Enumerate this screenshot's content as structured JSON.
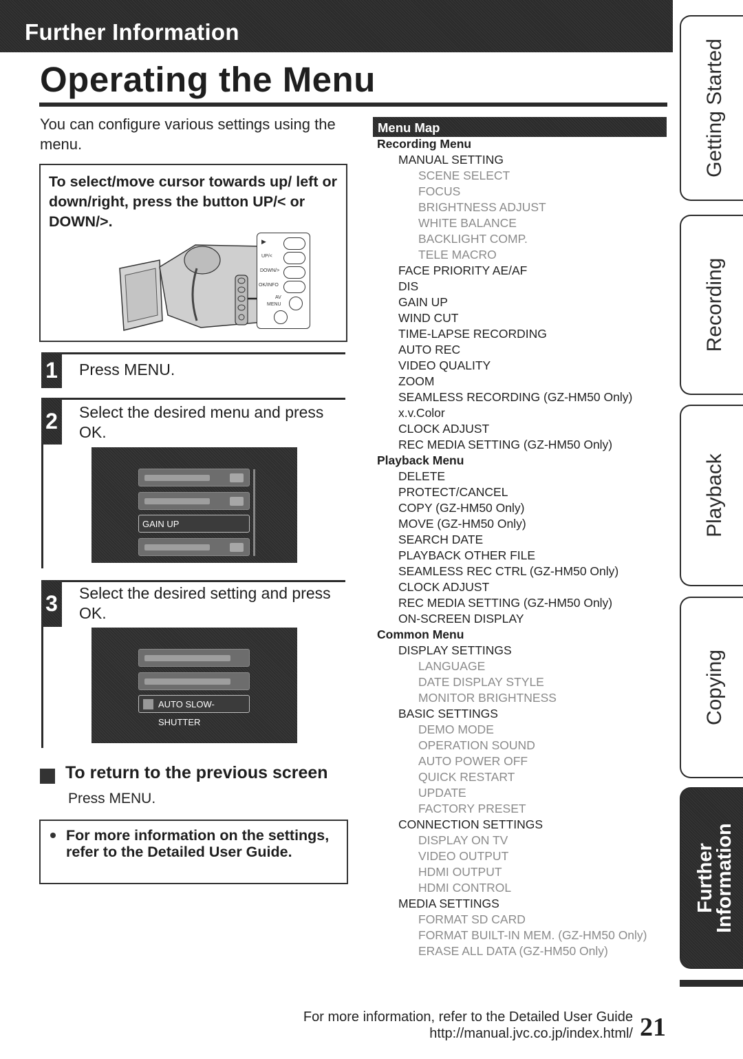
{
  "header": {
    "section_label": "Further Information",
    "page_title": "Operating the Menu"
  },
  "intro": "You can configure various settings using the menu.",
  "tip_box": {
    "text": "To select/move cursor towards up/ left or down/right, press the button UP/< or DOWN/>.",
    "panel_labels": [
      "▶",
      "UP/<",
      "DOWN/>",
      "OK/INFO",
      "AV",
      "MENU"
    ]
  },
  "steps": [
    {
      "number": "1",
      "text": "Press MENU."
    },
    {
      "number": "2",
      "text": "Select the desired menu and press OK.",
      "screen_items": [
        "",
        "",
        "GAIN UP",
        ""
      ],
      "selected_index": 2
    },
    {
      "number": "3",
      "text": "Select the desired setting and press OK.",
      "screen_items": [
        "",
        "",
        "AUTO SLOW-SHUTTER"
      ],
      "selected_index": 2
    }
  ],
  "return_section": {
    "heading": "To return to the previous screen",
    "text": "Press MENU."
  },
  "note": "For more information on the settings, refer to the Detailed User Guide.",
  "menu_map": {
    "title": "Menu Map",
    "items": [
      {
        "level": 0,
        "label": "Recording Menu"
      },
      {
        "level": 1,
        "label": "MANUAL SETTING"
      },
      {
        "level": 2,
        "label": "SCENE SELECT"
      },
      {
        "level": 2,
        "label": "FOCUS"
      },
      {
        "level": 2,
        "label": "BRIGHTNESS ADJUST"
      },
      {
        "level": 2,
        "label": "WHITE BALANCE"
      },
      {
        "level": 2,
        "label": "BACKLIGHT COMP."
      },
      {
        "level": 2,
        "label": "TELE MACRO"
      },
      {
        "level": 1,
        "label": "FACE PRIORITY AE/AF"
      },
      {
        "level": 1,
        "label": "DIS"
      },
      {
        "level": 1,
        "label": "GAIN UP"
      },
      {
        "level": 1,
        "label": "WIND CUT"
      },
      {
        "level": 1,
        "label": "TIME-LAPSE RECORDING"
      },
      {
        "level": 1,
        "label": "AUTO REC"
      },
      {
        "level": 1,
        "label": "VIDEO QUALITY"
      },
      {
        "level": 1,
        "label": "ZOOM"
      },
      {
        "level": 1,
        "label": "SEAMLESS RECORDING (GZ-HM50 Only)"
      },
      {
        "level": 1,
        "label": "x.v.Color"
      },
      {
        "level": 1,
        "label": "CLOCK ADJUST"
      },
      {
        "level": 1,
        "label": "REC MEDIA SETTING  (GZ-HM50 Only)"
      },
      {
        "level": 0,
        "label": "Playback Menu"
      },
      {
        "level": 1,
        "label": "DELETE"
      },
      {
        "level": 1,
        "label": "PROTECT/CANCEL"
      },
      {
        "level": 1,
        "label": "COPY (GZ-HM50 Only)"
      },
      {
        "level": 1,
        "label": "MOVE (GZ-HM50 Only)"
      },
      {
        "level": 1,
        "label": "SEARCH DATE"
      },
      {
        "level": 1,
        "label": "PLAYBACK OTHER FILE"
      },
      {
        "level": 1,
        "label": "SEAMLESS REC CTRL (GZ-HM50 Only)"
      },
      {
        "level": 1,
        "label": "CLOCK ADJUST"
      },
      {
        "level": 1,
        "label": "REC MEDIA SETTING (GZ-HM50 Only)"
      },
      {
        "level": 1,
        "label": "ON-SCREEN DISPLAY"
      },
      {
        "level": 0,
        "label": "Common Menu"
      },
      {
        "level": 1,
        "label": "DISPLAY SETTINGS"
      },
      {
        "level": 2,
        "label": "LANGUAGE"
      },
      {
        "level": 2,
        "label": "DATE DISPLAY STYLE"
      },
      {
        "level": 2,
        "label": "MONITOR BRIGHTNESS"
      },
      {
        "level": 1,
        "label": "BASIC SETTINGS"
      },
      {
        "level": 2,
        "label": "DEMO MODE"
      },
      {
        "level": 2,
        "label": "OPERATION SOUND"
      },
      {
        "level": 2,
        "label": "AUTO POWER OFF"
      },
      {
        "level": 2,
        "label": "QUICK RESTART"
      },
      {
        "level": 2,
        "label": "UPDATE"
      },
      {
        "level": 2,
        "label": "FACTORY PRESET"
      },
      {
        "level": 1,
        "label": "CONNECTION SETTINGS"
      },
      {
        "level": 2,
        "label": "DISPLAY ON TV"
      },
      {
        "level": 2,
        "label": "VIDEO OUTPUT"
      },
      {
        "level": 2,
        "label": "HDMI OUTPUT"
      },
      {
        "level": 2,
        "label": "HDMI CONTROL"
      },
      {
        "level": 1,
        "label": "MEDIA SETTINGS"
      },
      {
        "level": 2,
        "label": "FORMAT SD CARD"
      },
      {
        "level": 2,
        "label": "FORMAT BUILT-IN MEM. (GZ-HM50 Only)"
      },
      {
        "level": 2,
        "label": "ERASE ALL DATA (GZ-HM50 Only)"
      }
    ]
  },
  "side_tabs": [
    {
      "label": "Getting Started",
      "active": false
    },
    {
      "label": "Recording",
      "active": false
    },
    {
      "label": "Playback",
      "active": false
    },
    {
      "label": "Copying",
      "active": false
    },
    {
      "label": "Further Information",
      "line1": "Further",
      "line2": "Information",
      "active": true
    }
  ],
  "footer": {
    "line1": "For more information, refer to the Detailed User Guide",
    "line2": "http://manual.jvc.co.jp/index.html/",
    "page_number": "21"
  }
}
